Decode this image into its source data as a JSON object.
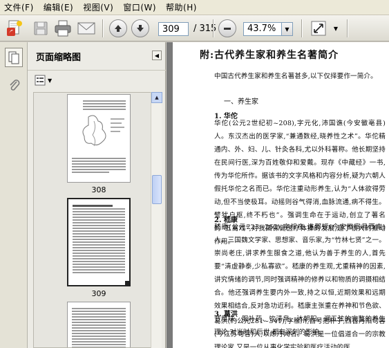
{
  "menu": [
    "文件(F)",
    "编辑(E)",
    "视图(V)",
    "窗口(W)",
    "帮助(H)"
  ],
  "toolbar": {
    "current_page": "309",
    "total_pages": "/ 315",
    "zoom": "43.7%",
    "icons": [
      "create-pdf-icon",
      "save-icon",
      "print-icon",
      "email-icon",
      "prev-page-icon",
      "next-page-icon",
      "zoom-out-icon",
      "fit-window-icon"
    ]
  },
  "panel": {
    "title": "页面缩略图",
    "thumbnails": [
      {
        "label": "308"
      },
      {
        "label": "309"
      }
    ]
  },
  "document": {
    "title": "附:古代养生家和养生名著简介",
    "intro": "中国古代养生家和养生名著甚多,以下仅择要作一简介。",
    "section": "一、养生家",
    "s1_title": "1. 华佗",
    "s1_text": "华佗(公元2世纪初~208),字元化,沛国谯(今安徽亳县)人。东汉杰出的医学家,“兼通数经,晓养性之术”。华佗精通内、外、妇、儿、针灸各科,尤以外科著称。他长期坚持在民间行医,深为百姓敬仰和爱戴。现存《中藏经》一书,传为华佗所作。据该书的文字风格和内容分析,疑为六朝人假托华佗之名而已。华佗注重动形养生,认为“人体欲得劳动,但不当使极耳。动摇则谷气得消,血脉流通,病不得生。譬犹户枢,终不朽也”。强调生命在于运动,创立了著名的“五禽戏”,对我国保健医疗体操的发展,起了很大的推动作用。",
    "s2_title": "2. 嵇康",
    "s2_text": "嵇康(公元223~262),字叔夜,谯郡铚(今安徽宿县西南)人。三国魏文学家、思想家、音乐家,为“竹林七贤”之一。崇尚老庄,讲求养生服食之道,他认为善于养生的人,首先要“清虚静泰,少私寡欲”。嵇康的养生观,尤重精神的因素,讲究情绪的调节,同时强调精神的修养以和物质的调摄相结合。他还强调养生要内外一致,持之以恒,近期效果和远期效果相结合,反对急功近利。嵇康主张重在养神和节色欲、节厚味、服补药、饮清泉、沐朝阳、调五弦的完整的养生理论,对当时和后世,都有深刻的影响。",
    "s3_title": "3. 葛洪",
    "s3_text": "葛洪(约公元281~341),字稚川,自号抱朴子,西晋丹阳句容(今江苏句容)人,以炼丹闻名。葛洪是一位倡道合一的宗教理论家,又是一位从事化学实验和医疗活动的医"
  }
}
